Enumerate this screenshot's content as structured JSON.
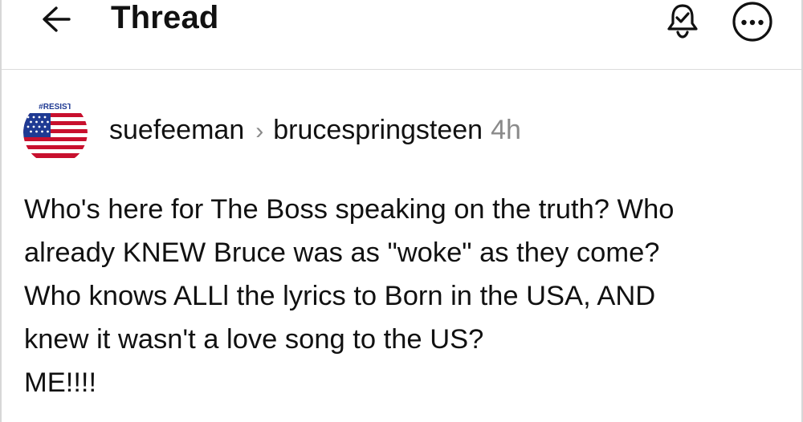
{
  "header": {
    "back_icon": "arrow-left-icon",
    "title": "Thread",
    "notify_icon": "bell-check-icon",
    "more_icon": "more-horizontal-icon"
  },
  "post": {
    "avatar_icon": "us-flag-resist-avatar",
    "avatar_text": "#RESIST",
    "username": "suefeeman",
    "separator": "›",
    "community": "brucespringsteen",
    "time": "4h",
    "body_lines": [
      "Who's here for The Boss speaking on the truth? Who",
      "already KNEW Bruce was as \"woke\"  as they come?",
      "Who knows ALLl the lyrics to Born in the USA, AND",
      "knew it wasn't a love song to the US?",
      "ME!!!!"
    ]
  },
  "colors": {
    "text": "#111111",
    "muted": "#8a8a8a",
    "divider": "#dcdcdc",
    "flag_red": "#c8102e",
    "flag_blue": "#1f3a93"
  }
}
